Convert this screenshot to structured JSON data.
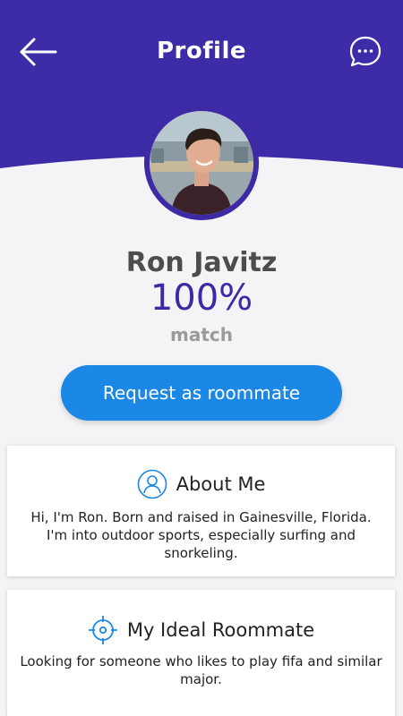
{
  "header": {
    "title": "Profile",
    "back_icon": "arrow-left-icon",
    "chat_icon": "chat-bubble-icon",
    "color": "#3d2ca8"
  },
  "profile": {
    "name": "Ron Javitz",
    "match_percent": "100%",
    "match_label": "match"
  },
  "actions": {
    "request_label": "Request as roommate",
    "accent": "#1b87e6"
  },
  "about": {
    "icon": "user-circle-icon",
    "title": "About Me",
    "text": "Hi, I'm Ron. Born and raised in Gainesville, Florida. I'm into outdoor sports, especially surfing and snorkeling."
  },
  "ideal": {
    "icon": "target-icon",
    "title": "My Ideal Roommate",
    "text": "Looking for someone who likes to play fifa and similar major."
  }
}
